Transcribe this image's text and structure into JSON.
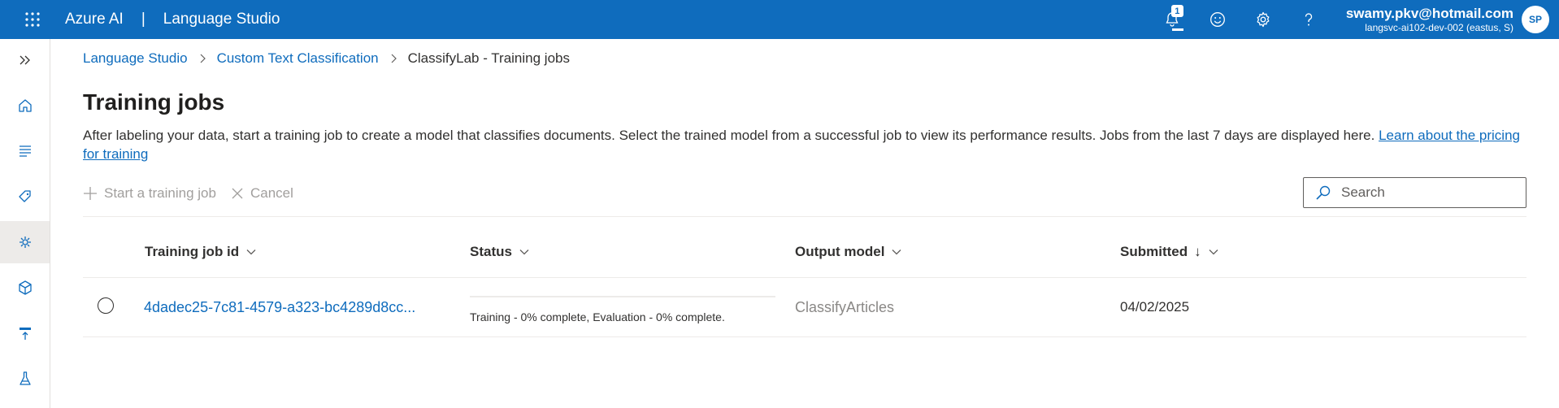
{
  "topbar": {
    "brand": "Azure AI",
    "separator": "|",
    "product": "Language Studio",
    "notifications_count": "1",
    "user_email": "swamy.pkv@hotmail.com",
    "resource": "langsvc-ai102-dev-002 (eastus, S)",
    "avatar_initials": "SP",
    "color": "#0f6cbd"
  },
  "breadcrumb": {
    "items": [
      "Language Studio",
      "Custom Text Classification"
    ],
    "current": "ClassifyLab - Training jobs"
  },
  "page": {
    "title": "Training jobs",
    "description": "After labeling your data, start a training job to create a model that classifies documents. Select the trained model from a successful job to view its performance results. Jobs from the last 7 days are displayed here. ",
    "link": "Learn about the pricing for training"
  },
  "toolbar": {
    "start_label": "Start a training job",
    "cancel_label": "Cancel",
    "search_placeholder": "Search"
  },
  "table": {
    "columns": [
      "Training job id",
      "Status",
      "Output model",
      "Submitted"
    ],
    "submitted_sort": "↓",
    "rows": [
      {
        "job_id": "4dadec25-7c81-4579-a323-bc4289d8cc...",
        "progress": 0,
        "status": "Training - 0% complete, Evaluation - 0% complete.",
        "output_model": "ClassifyArticles",
        "submitted": "04/02/2025"
      }
    ]
  },
  "leftnav": {
    "icons": [
      "expand-icon",
      "home-icon",
      "document-list-icon",
      "tag-icon",
      "training-icon",
      "model-cube-icon",
      "deploy-icon",
      "test-flask-icon"
    ],
    "selected": "training-icon"
  }
}
